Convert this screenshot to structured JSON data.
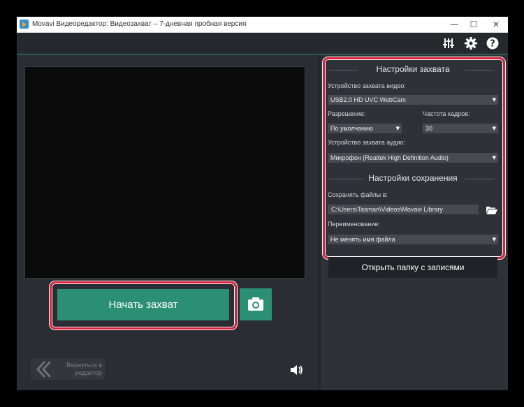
{
  "window": {
    "title": "Movavi Видеоредактор: Видеозахват – 7-дневная пробная версия",
    "minimize": "—",
    "maximize": "☐",
    "close": "✕"
  },
  "toolbar": {
    "icons": [
      "equalizer-icon",
      "gear-icon",
      "help-icon"
    ]
  },
  "capture": {
    "start_label": "Начать захват",
    "snapshot_icon": "camera-icon",
    "back_label_line1": "Вернуться в",
    "back_label_line2": "редактор",
    "volume_icon": "speaker-icon"
  },
  "settings": {
    "capture_title": "Настройки захвата",
    "video_device_label": "Устройство захвата видео:",
    "video_device_value": "USB2.0 HD UVC WebCam",
    "resolution_label": "Разрешение:",
    "resolution_value": "По умолчанию",
    "framerate_label": "Частота кадров:",
    "framerate_value": "30",
    "audio_device_label": "Устройство захвата аудио:",
    "audio_device_value": "Микрофон (Realtek High Definition Audio)",
    "save_title": "Настройки сохранения",
    "save_to_label": "Сохранять файлы в:",
    "save_to_value": "C:\\Users\\Tasman\\Videos\\Movavi Library",
    "rename_label": "Переименование:",
    "rename_value": "Не менять имя файла",
    "open_folder_label": "Открыть папку с записями"
  },
  "colors": {
    "accent": "#2b8f74",
    "highlight": "#d8213a",
    "background": "#2a2d33"
  }
}
